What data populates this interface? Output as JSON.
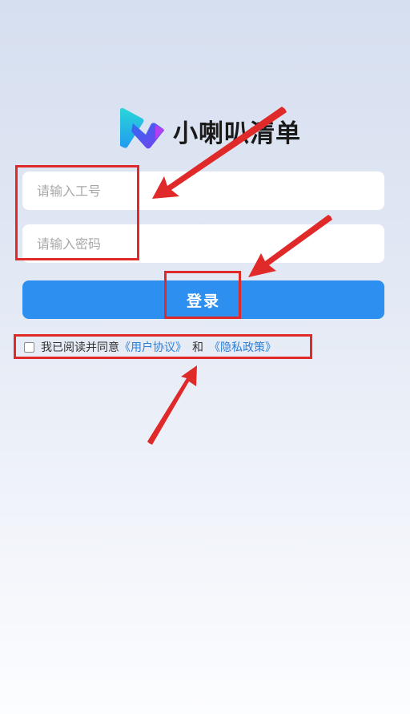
{
  "app": {
    "name": "小喇叭清单"
  },
  "form": {
    "employee_id_placeholder": "请输入工号",
    "employee_id_value": "",
    "password_placeholder": "请输入密码",
    "password_value": "",
    "login_label": "登录"
  },
  "agreement": {
    "checked": false,
    "prefix": "我已阅读并同意",
    "user_agreement": "《用户协议》",
    "conjunction": "和",
    "privacy_policy": "《隐私政策》"
  },
  "colors": {
    "primary": "#2d8ff0",
    "link": "#2d7fd6",
    "annotation": "#e02a2a"
  }
}
